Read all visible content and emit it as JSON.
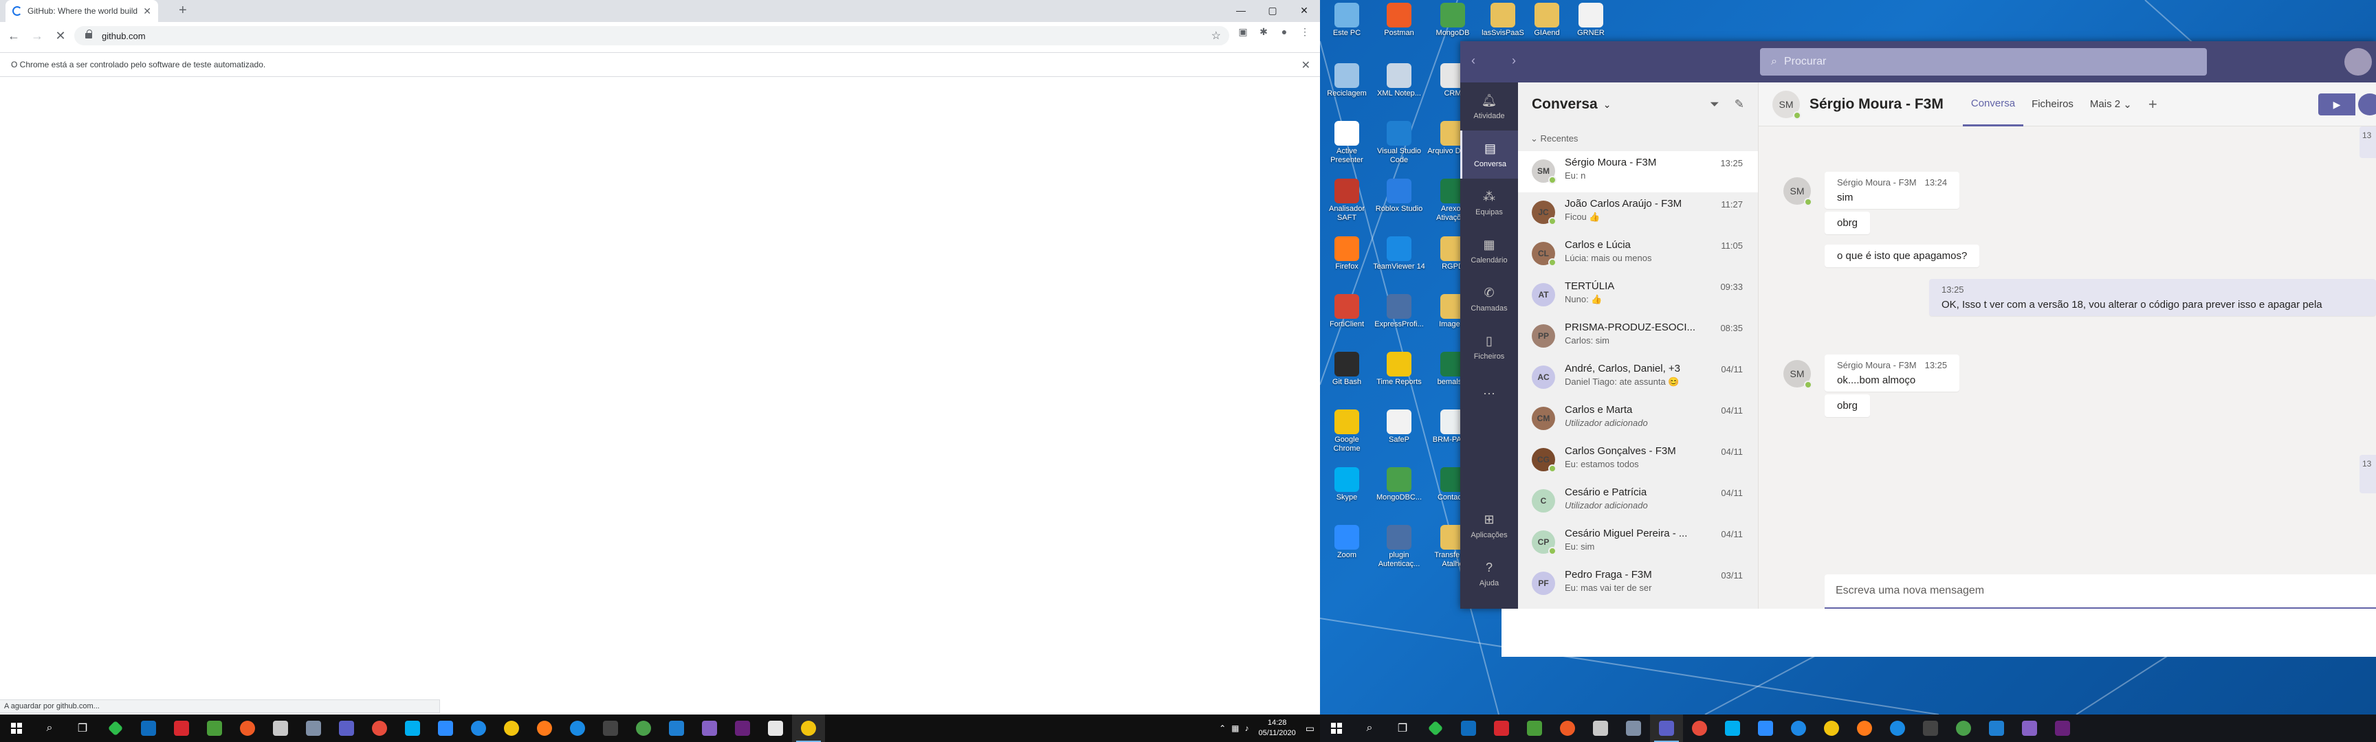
{
  "chrome": {
    "tab_title": "GitHub: Where the world builds",
    "url": "github.com",
    "infobar_text": "O Chrome está a ser controlado pelo software de teste automatizado.",
    "status_text": "A aguardar por github.com..."
  },
  "taskbar_left": {
    "time": "14:28",
    "date": "05/11/2020"
  },
  "desktop_icons": [
    {
      "label": "Este PC",
      "icon": "pc-icon",
      "color": "#6fb3e6"
    },
    {
      "label": "Postman",
      "icon": "postman-icon",
      "color": "#ef5b25"
    },
    {
      "label": "MongoDB",
      "icon": "mongodb-icon",
      "color": "#4aa04a"
    },
    {
      "label": "lasSvisPaaS",
      "icon": "folder-icon",
      "color": "#e8c15c"
    },
    {
      "label": "GIAend",
      "icon": "folder-icon",
      "color": "#e8c15c"
    },
    {
      "label": "GRNER",
      "icon": "file-icon",
      "color": "#f2f2f2"
    },
    {
      "label": "Reciclagem",
      "icon": "recycle-bin-icon",
      "color": "#9cc3e6"
    },
    {
      "label": "XML Notep...",
      "icon": "xml-notepad-icon",
      "color": "#c8d6e5"
    },
    {
      "label": "CRM",
      "icon": "crm-icon",
      "color": "#e6e6e6"
    },
    {
      "label": "Active Presenter",
      "icon": "activepresenter-icon",
      "color": "#ffffff"
    },
    {
      "label": "Visual Studio Code",
      "icon": "vscode-icon",
      "color": "#1f7fd1"
    },
    {
      "label": "Arquivo DMCN",
      "icon": "folder-icon",
      "color": "#e8c15c"
    },
    {
      "label": "Analisador SAFT",
      "icon": "saft-icon",
      "color": "#c0392b"
    },
    {
      "label": "Roblox Studio",
      "icon": "roblox-icon",
      "color": "#2a7de1"
    },
    {
      "label": "Arexos Ativações",
      "icon": "excel-icon",
      "color": "#1d7a45"
    },
    {
      "label": "Firefox",
      "icon": "firefox-icon",
      "color": "#ff7a1a"
    },
    {
      "label": "TeamViewer 14",
      "icon": "teamviewer-icon",
      "color": "#1a8ae3"
    },
    {
      "label": "RGPD",
      "icon": "folder-icon",
      "color": "#e8c15c"
    },
    {
      "label": "FortiClient",
      "icon": "forticlient-icon",
      "color": "#d64533"
    },
    {
      "label": "ExpressProfi...",
      "icon": "expressprofiler-icon",
      "color": "#4a6fa5"
    },
    {
      "label": "Imagem",
      "icon": "folder-icon",
      "color": "#e8c15c"
    },
    {
      "label": "Git Bash",
      "icon": "gitbash-icon",
      "color": "#2b2b2b"
    },
    {
      "label": "Time Reports",
      "icon": "chrome-icon",
      "color": "#f2c40f"
    },
    {
      "label": "bemals...",
      "icon": "excel-icon",
      "color": "#1d7a45"
    },
    {
      "label": "Google Chrome",
      "icon": "chrome-icon",
      "color": "#f2c40f"
    },
    {
      "label": "SafeP",
      "icon": "safep-icon",
      "color": "#f2f2f2"
    },
    {
      "label": "BRM-PAS...",
      "icon": "brm-icon",
      "color": "#ecf0f1"
    },
    {
      "label": "Skype",
      "icon": "skype-icon",
      "color": "#00aff0"
    },
    {
      "label": "MongoDBC...",
      "icon": "mongodb-icon",
      "color": "#4aa04a"
    },
    {
      "label": "Contacto",
      "icon": "excel-icon",
      "color": "#1d7a45"
    },
    {
      "label": "Zoom",
      "icon": "zoom-icon",
      "color": "#2d8cff"
    },
    {
      "label": "plugin Autenticaç...",
      "icon": "plugin-icon",
      "color": "#4a6fa5"
    },
    {
      "label": "Transferir - Atalho",
      "icon": "folder-icon",
      "color": "#e8c15c"
    }
  ],
  "teams": {
    "search_placeholder": "Procurar",
    "rail": [
      {
        "label": "Atividade",
        "icon": "bell-icon"
      },
      {
        "label": "Conversa",
        "icon": "chat-icon"
      },
      {
        "label": "Equipas",
        "icon": "teams-icon"
      },
      {
        "label": "Calendário",
        "icon": "calendar-icon"
      },
      {
        "label": "Chamadas",
        "icon": "phone-icon"
      },
      {
        "label": "Ficheiros",
        "icon": "file-icon"
      },
      {
        "label": "Aplicações",
        "icon": "apps-icon"
      },
      {
        "label": "Ajuda",
        "icon": "help-icon"
      }
    ],
    "list_title": "Conversa",
    "section": "Recentes",
    "chats": [
      {
        "initials": "SM",
        "name": "Sérgio Moura - F3M",
        "preview": "Eu: n",
        "time": "13:25",
        "avatar_color": "#d2d0ce"
      },
      {
        "initials": "JC",
        "name": "João Carlos Araújo - F3M",
        "preview": "Ficou 👍",
        "time": "11:27",
        "avatar_color": "#8a5a3c"
      },
      {
        "initials": "CL",
        "name": "Carlos e Lúcia",
        "preview": "Lúcia: mais ou menos",
        "time": "11:05",
        "avatar_color": "#9a6f56"
      },
      {
        "initials": "AT",
        "name": "TERTÚLIA",
        "preview": "Nuno: 👍",
        "time": "09:33",
        "avatar_color": "#c7c6e8"
      },
      {
        "initials": "PP",
        "name": "PRISMA-PRODUZ-ESOCI...",
        "preview": "Carlos: sim",
        "time": "08:35",
        "avatar_color": "#a08070"
      },
      {
        "initials": "AC",
        "name": "André, Carlos, Daniel, +3",
        "preview": "Daniel Tiago: ate assunta 😊",
        "time": "04/11",
        "avatar_color": "#c7c6e8"
      },
      {
        "initials": "CM",
        "name": "Carlos e Marta",
        "preview": "Utilizador adicionado",
        "time": "04/11",
        "avatar_color": "#9a6f56"
      },
      {
        "initials": "CG",
        "name": "Carlos Gonçalves - F3M",
        "preview": "Eu: estamos todos",
        "time": "04/11",
        "avatar_color": "#7a4a2c"
      },
      {
        "initials": "C",
        "name": "Cesário e Patrícia",
        "preview": "Utilizador adicionado",
        "time": "04/11",
        "avatar_color": "#b8d9c0"
      },
      {
        "initials": "CP",
        "name": "Cesário Miguel Pereira - ...",
        "preview": "Eu: sim",
        "time": "04/11",
        "avatar_color": "#b8d9c0"
      },
      {
        "initials": "PF",
        "name": "Pedro Fraga - F3M",
        "preview": "Eu: mas vai ter de ser",
        "time": "03/11",
        "avatar_color": "#c7c6e8"
      }
    ],
    "conversation": {
      "initials": "SM",
      "name": "Sérgio Moura - F3M",
      "tabs": [
        "Conversa",
        "Ficheiros",
        "Mais 2"
      ],
      "messages": [
        {
          "from": "Sérgio Moura - F3M",
          "time": "13:24",
          "lines": [
            "sim",
            "obrg",
            "o que é isto que apagamos?"
          ]
        },
        {
          "from": "me",
          "time": "13:25",
          "lines": [
            "OK, Isso t ver com a versão 18, vou alterar o código para prever isso e apagar pela"
          ]
        },
        {
          "from": "Sérgio Moura - F3M",
          "time": "13:25",
          "lines": [
            "ok....bom almoço",
            "obrg"
          ]
        }
      ],
      "compose_placeholder": "Escreva uma nova mensagem"
    }
  }
}
